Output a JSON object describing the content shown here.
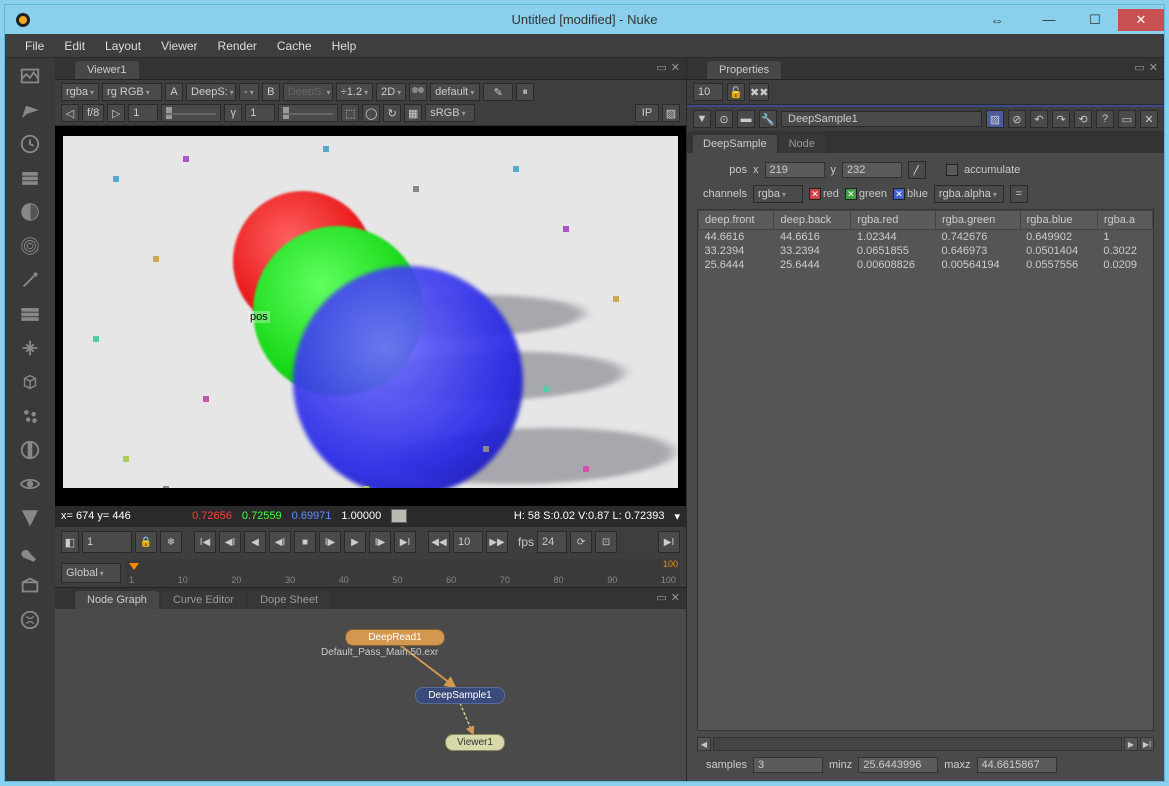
{
  "window": {
    "title": "Untitled [modified] - Nuke"
  },
  "menubar": [
    "File",
    "Edit",
    "Layout",
    "Viewer",
    "Render",
    "Cache",
    "Help"
  ],
  "centerTabs": {
    "viewer": "Viewer1"
  },
  "viewerToolbar": {
    "ch1": "rgba",
    "ch2": "rg RGB",
    "labelA": "A",
    "aSel": "DeepS:",
    "dash": "-",
    "labelB": "B",
    "bSel": "DeepS:",
    "zoom": "÷1.2",
    "dim": "2D",
    "preset": "default",
    "fstop": "f/8",
    "exp": "1",
    "gamma": "γ",
    "gval": "1",
    "cspace": "sRGB",
    "ip": "IP"
  },
  "posLabel": "pos",
  "statusbar": {
    "coords": "x= 674 y= 446",
    "r": "0.72656",
    "g": "0.72559",
    "b": "0.69971",
    "a": "1.00000",
    "hsv": "H: 58 S:0.02 V:0.87  L: 0.72393"
  },
  "transport": {
    "frame": "1",
    "playFrame": "10",
    "fpsLabel": "fps",
    "fps": "24"
  },
  "timeline": {
    "mode": "Global",
    "ticks": [
      "1",
      "10",
      "20",
      "30",
      "40",
      "50",
      "60",
      "70",
      "80",
      "90",
      "100"
    ],
    "endLabel": "100"
  },
  "nodeTabs": {
    "graph": "Node Graph",
    "curve": "Curve Editor",
    "dope": "Dope Sheet"
  },
  "nodes": {
    "deepread": "DeepRead1",
    "filepath": "Default_Pass_Main.50.exr",
    "deepsample": "DeepSample1",
    "viewer": "Viewer1"
  },
  "rightTabs": {
    "props": "Properties"
  },
  "propsToolbar": {
    "count": "10"
  },
  "propsNode": {
    "name": "DeepSample1",
    "tabs": {
      "main": "DeepSample",
      "node": "Node"
    }
  },
  "props": {
    "posLabel": "pos",
    "xLabel": "x",
    "xVal": "219",
    "yLabel": "y",
    "yVal": "232",
    "accumLabel": "accumulate",
    "channelsLabel": "channels",
    "channelsVal": "rgba",
    "redLabel": "red",
    "greenLabel": "green",
    "blueLabel": "blue",
    "alphaSel": "rgba.alpha",
    "eq": "=",
    "table": {
      "headers": [
        "deep.front",
        "deep.back",
        "rgba.red",
        "rgba.green",
        "rgba.blue",
        "rgba.a"
      ],
      "rows": [
        [
          "44.6616",
          "44.6616",
          "1.02344",
          "0.742676",
          "0.649902",
          "1"
        ],
        [
          "33.2394",
          "33.2394",
          "0.0651855",
          "0.646973",
          "0.0501404",
          "0.3022"
        ],
        [
          "25.6444",
          "25.6444",
          "0.00608826",
          "0.00564194",
          "0.0557556",
          "0.0209"
        ]
      ]
    },
    "samplesLabel": "samples",
    "samplesVal": "3",
    "minzLabel": "minz",
    "minzVal": "25.6443996",
    "maxzLabel": "maxz",
    "maxzVal": "44.6615867"
  }
}
